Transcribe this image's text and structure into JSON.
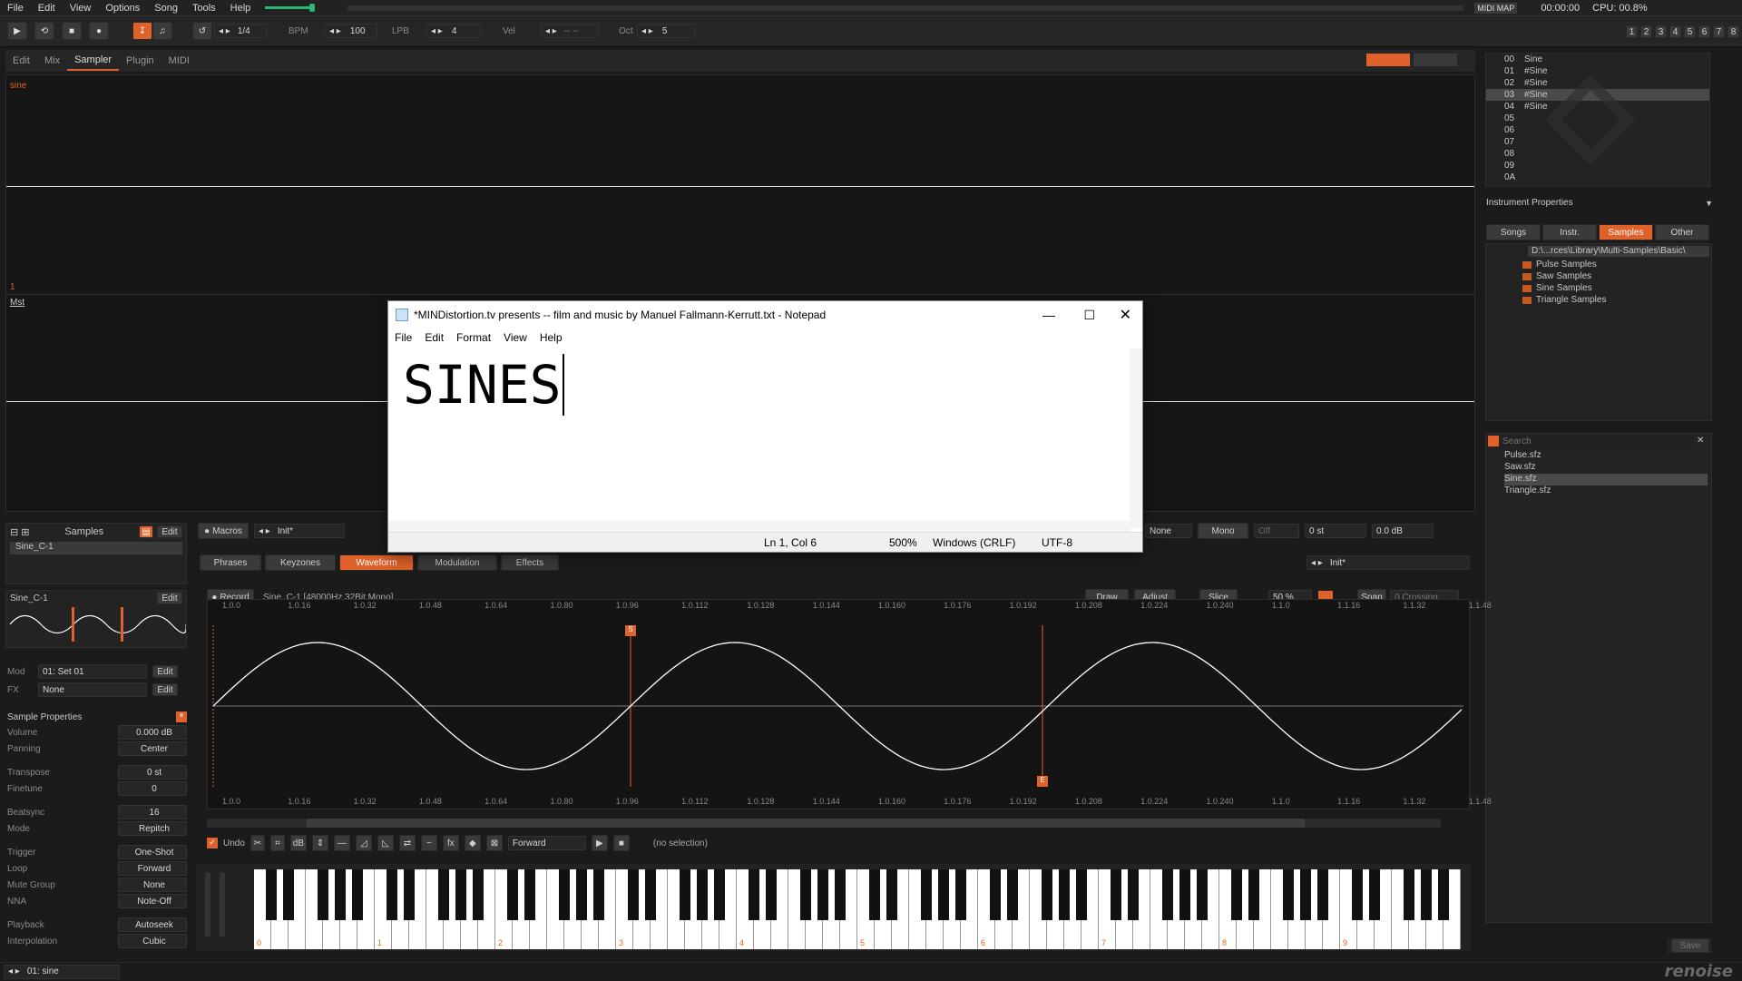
{
  "menu": [
    "File",
    "Edit",
    "View",
    "Options",
    "Song",
    "Tools",
    "Help"
  ],
  "toolbar": {
    "step_value": "1/4",
    "bpm_label": "BPM",
    "bpm_value": "100",
    "lpb_label": "LPB",
    "lpb_value": "4",
    "vel_label": "Vel",
    "vel_value": "-- --",
    "oct_label": "Oct",
    "oct_value": "5",
    "midi_map": "MIDI MAP",
    "time": "00:00:00",
    "cpu": "CPU: 00.8%",
    "tracks": [
      "1",
      "2",
      "3",
      "4",
      "5",
      "6",
      "7",
      "8"
    ]
  },
  "tabs": [
    "Edit",
    "Mix",
    "Sampler",
    "Plugin",
    "MIDI"
  ],
  "active_tab": "Sampler",
  "scope": {
    "top_label": "sine",
    "mid_marker": "1",
    "bottom_label": "Mst"
  },
  "notepad": {
    "title": "*MINDistortion.tv presents -- film and music by Manuel Fallmann-Kerrutt.txt - Notepad",
    "menu": [
      "File",
      "Edit",
      "Format",
      "View",
      "Help"
    ],
    "content": "SINES",
    "status_pos": "Ln 1, Col 6",
    "status_zoom": "500%",
    "status_eol": "Windows (CRLF)",
    "status_enc": "UTF-8"
  },
  "instrument_list": {
    "rows": [
      {
        "num": "00",
        "name": "Sine"
      },
      {
        "num": "01",
        "name": "#Sine"
      },
      {
        "num": "02",
        "name": "#Sine"
      },
      {
        "num": "03",
        "name": "#Sine",
        "selected": true
      },
      {
        "num": "04",
        "name": "#Sine"
      },
      {
        "num": "05",
        "name": ""
      },
      {
        "num": "06",
        "name": ""
      },
      {
        "num": "07",
        "name": ""
      },
      {
        "num": "08",
        "name": ""
      },
      {
        "num": "09",
        "name": ""
      },
      {
        "num": "0A",
        "name": ""
      }
    ]
  },
  "instrument_properties": "Instrument Properties",
  "browser_tabs": [
    "Songs",
    "Instr.",
    "Samples",
    "Other"
  ],
  "browser_active": "Samples",
  "browser_path": "D:\\...rces\\Library\\Multi-Samples\\Basic\\",
  "browser_folders": [
    "Pulse Samples",
    "Saw Samples",
    "Sine Samples",
    "Triangle Samples"
  ],
  "search_placeholder": "Search",
  "search_results": [
    "Pulse.sfz",
    "Saw.sfz",
    "Sine.sfz",
    "Triangle.sfz"
  ],
  "search_selected": "Sine.sfz",
  "save_label": "Save",
  "samples_panel": {
    "title": "Samples",
    "edit": "Edit",
    "sample_name": "Sine_C-1",
    "sample_name2": "Sine_C-1",
    "mod_label": "Mod",
    "mod_value": "01: Set 01",
    "fx_label": "FX",
    "fx_value": "None"
  },
  "macros": {
    "label": "Macros",
    "preset": "Init*"
  },
  "right_bar": {
    "none": "None",
    "mono": "Mono",
    "off": "Off",
    "transpose": "0 st",
    "volume": "0.0 dB",
    "preset": "Init*"
  },
  "editor_tabs": [
    "Phrases",
    "Keyzones",
    "Waveform",
    "Modulation",
    "Effects"
  ],
  "editor_active": "Waveform",
  "sample_props": {
    "title": "Sample Properties",
    "items": [
      {
        "label": "Volume",
        "value": "0.000 dB"
      },
      {
        "label": "Panning",
        "value": "Center"
      },
      {
        "label": "Transpose",
        "value": "0 st"
      },
      {
        "label": "Finetune",
        "value": "0"
      },
      {
        "label": "Beatsync",
        "value": "16"
      },
      {
        "label": "Mode",
        "value": "Repitch"
      },
      {
        "label": "Trigger",
        "value": "One-Shot"
      },
      {
        "label": "Loop",
        "value": "Forward"
      },
      {
        "label": "Mute Group",
        "value": "None"
      },
      {
        "label": "NNA",
        "value": "Note-Off"
      },
      {
        "label": "Playback",
        "value": "Autoseek"
      },
      {
        "label": "Interpolation",
        "value": "Cubic"
      }
    ],
    "beatsync_t": "T"
  },
  "waveform": {
    "record": "Record",
    "info": "Sine_C-1 [48000Hz 32Bit Mono]",
    "draw": "Draw",
    "adjust": "Adjust",
    "slice": "Slice",
    "zoom": "50 %",
    "snap": "Snap",
    "snap_mode": "0 Crossing",
    "ruler": [
      "1.0.0",
      "1.0.16",
      "1.0.32",
      "1.0.48",
      "1.0.64",
      "1.0.80",
      "1.0.96",
      "1.0.112",
      "1.0.128",
      "1.0.144",
      "1.0.160",
      "1.0.176",
      "1.0.192",
      "1.0.208",
      "1.0.224",
      "1.0.240",
      "1.1.0",
      "1.1.16",
      "1.1.32",
      "1.1.48"
    ],
    "start_marker": "S",
    "end_marker": "E",
    "undo": "Undo",
    "loop_mode": "Forward",
    "selection": "(no selection)"
  },
  "keyboard_octaves": [
    "0",
    "1",
    "2",
    "3",
    "4",
    "5",
    "6",
    "7",
    "8",
    "9"
  ],
  "status_bar": {
    "instrument": "01: sine",
    "logo": "renoise"
  },
  "colors": {
    "accent": "#e0622a",
    "bg": "#1b1b1b",
    "wave": "#ffffff"
  }
}
